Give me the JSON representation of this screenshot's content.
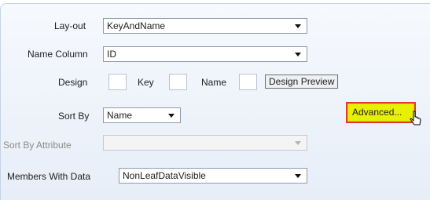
{
  "layout": {
    "label": "Lay-out",
    "value": "KeyAndName"
  },
  "name_column": {
    "label": "Name Column",
    "value": "ID"
  },
  "design": {
    "label": "Design",
    "key_label": "Key",
    "name_label": "Name",
    "preview_button": "Design Preview"
  },
  "sort_by": {
    "label": "Sort By",
    "value": "Name"
  },
  "advanced_button": "Advanced...",
  "sort_by_attribute": {
    "label": "Sort By Attribute",
    "value": ""
  },
  "members_with_data": {
    "label": "Members With Data",
    "value": "NonLeafDataVisible"
  },
  "colors": {
    "highlight": "#e6f000",
    "highlight_border": "#e23a2a"
  }
}
